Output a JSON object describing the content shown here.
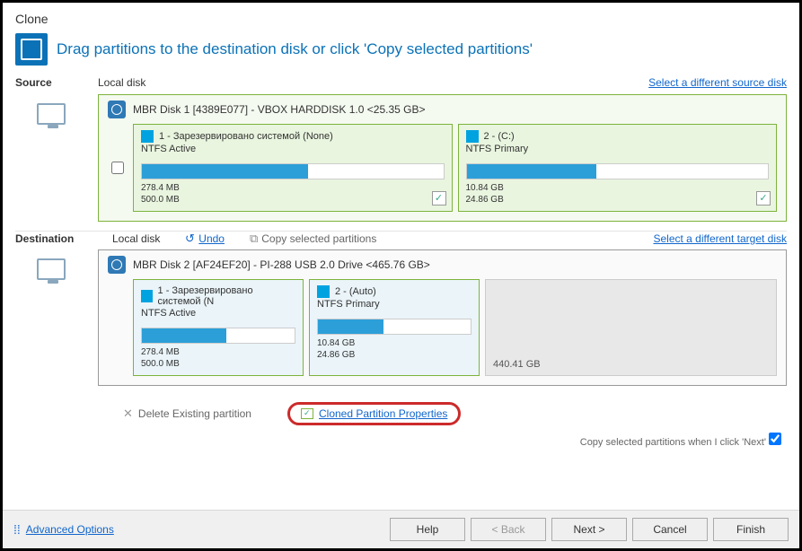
{
  "window_title": "Clone",
  "banner_text": "Drag partitions to the destination disk or click 'Copy selected partitions'",
  "source": {
    "label": "Source",
    "sub": "Local disk",
    "link": "Select a different source disk",
    "disk_title": "MBR Disk 1 [4389E077] - VBOX HARDDISK 1.0  <25.35 GB>",
    "partitions": [
      {
        "title": "1 - Зарезервировано системой (None)",
        "fs": "NTFS Active",
        "used": "278.4 MB",
        "total": "500.0 MB",
        "fill_pct": 55,
        "checked": true
      },
      {
        "title": "2 -  (C:)",
        "fs": "NTFS Primary",
        "used": "10.84 GB",
        "total": "24.86 GB",
        "fill_pct": 43,
        "checked": true
      }
    ]
  },
  "destination": {
    "label": "Destination",
    "sub": "Local disk",
    "undo": "Undo",
    "copy_sel": "Copy selected partitions",
    "link": "Select a different target disk",
    "disk_title": "MBR Disk 2 [AF24EF20] - PI-288   USB 2.0 Drive  <465.76 GB>",
    "partitions": [
      {
        "title": "1 - Зарезервировано системой (N",
        "fs": "NTFS Active",
        "used": "278.4 MB",
        "total": "500.0 MB",
        "fill_pct": 55
      },
      {
        "title": "2 -  (Auto)",
        "fs": "NTFS Primary",
        "used": "10.84 GB",
        "total": "24.86 GB",
        "fill_pct": 43
      }
    ],
    "unallocated": "440.41 GB",
    "delete_existing": "Delete Existing partition",
    "cloned_props": "Cloned Partition Properties",
    "hint": "Copy selected partitions when I click 'Next'"
  },
  "footer": {
    "advanced": "Advanced Options",
    "help": "Help",
    "back": "< Back",
    "next": "Next >",
    "cancel": "Cancel",
    "finish": "Finish"
  }
}
